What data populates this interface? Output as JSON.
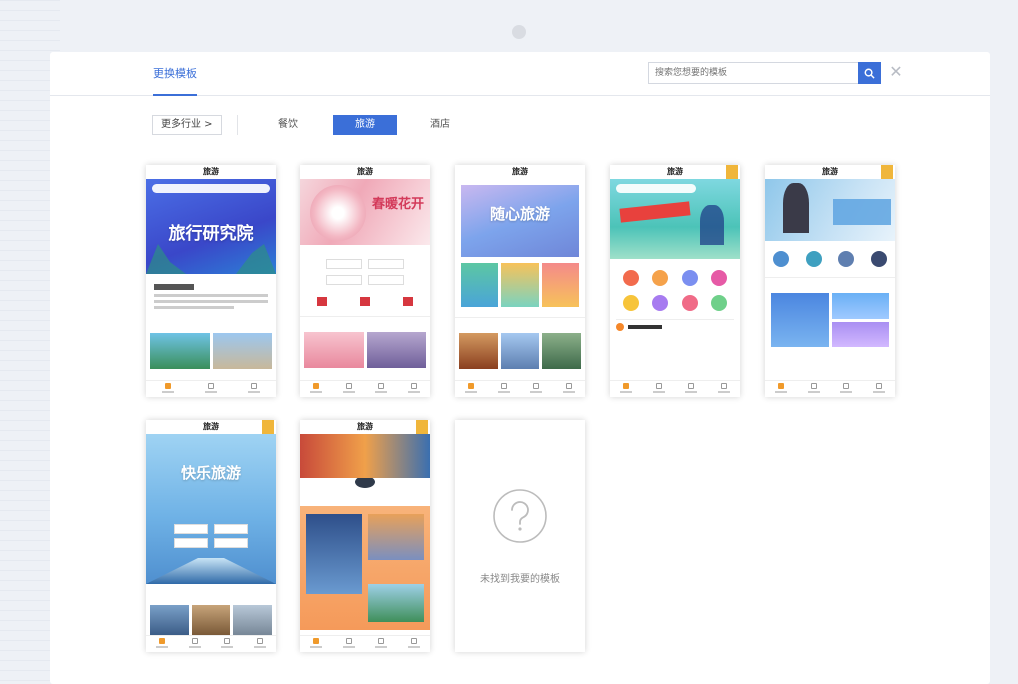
{
  "header": {
    "tab_label": "更换模板",
    "search_placeholder": "搜索您想要的模板"
  },
  "filters": {
    "more_label": "更多行业 >",
    "categories": [
      {
        "label": "餐饮",
        "active": false
      },
      {
        "label": "旅游",
        "active": true
      },
      {
        "label": "酒店",
        "active": false
      }
    ]
  },
  "templates": {
    "card_title": "旅游",
    "t1_banner": "旅行研究院",
    "t2_banner": "春暖花开",
    "t3_banner": "随心旅游",
    "t6_banner": "快乐旅游",
    "empty_text": "未找到我要的模板"
  },
  "colors": {
    "accent": "#3b6fd8",
    "ribbon": "#f0b63b"
  }
}
